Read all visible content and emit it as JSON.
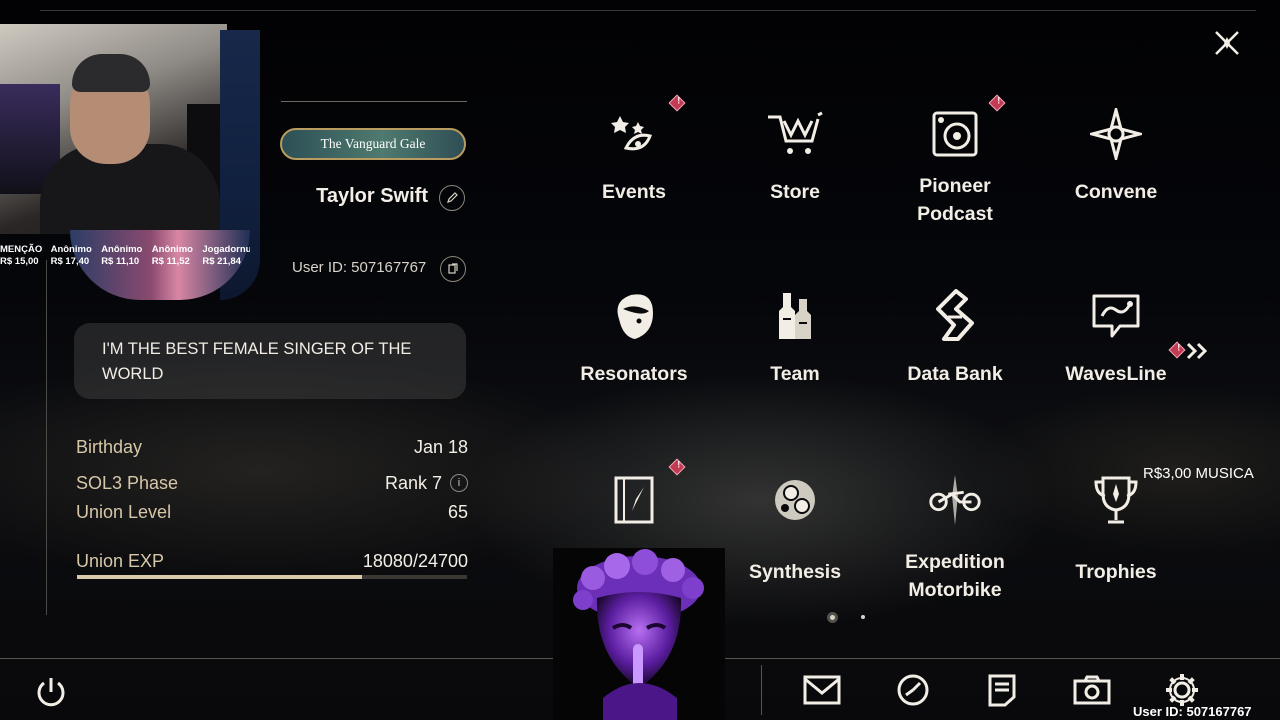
{
  "overlay": {
    "donors": [
      {
        "name": "MENÇÃO",
        "amount": "R$ 15,00"
      },
      {
        "name": "Anônimo",
        "amount": "R$ 17,40"
      },
      {
        "name": "Anônimo",
        "amount": "R$ 11,10"
      },
      {
        "name": "Anônimo",
        "amount": "R$ 11,52"
      },
      {
        "name": "Jogadornume",
        "amount": "R$ 21,84"
      }
    ],
    "music_donation": "R$3,00 MUSICA",
    "bottom_uid": "User ID: 507167767"
  },
  "profile": {
    "title_badge": "The Vanguard Gale",
    "name": "Taylor Swift",
    "user_id": "User ID: 507167767",
    "signature": "I'M THE BEST FEMALE SINGER OF THE WORLD",
    "stats": {
      "birthday_label": "Birthday",
      "birthday_value": "Jan 18",
      "phase_label": "SOL3 Phase",
      "phase_value": "Rank 7",
      "union_level_label": "Union Level",
      "union_level_value": "65",
      "exp_label": "Union EXP",
      "exp_value": "18080/24700",
      "exp_fraction": 0.732
    }
  },
  "menu": {
    "events": "Events",
    "store": "Store",
    "podcast_line1": "Pioneer",
    "podcast_line2": "Podcast",
    "convene": "Convene",
    "resonators": "Resonators",
    "team": "Team",
    "data_bank": "Data Bank",
    "wavesline": "WavesLine",
    "synthesis": "Synthesis",
    "motorbike_line1": "Expedition",
    "motorbike_line2": "Motorbike",
    "trophies": "Trophies",
    "page_count": 2,
    "current_page": 1
  },
  "icons": {
    "close": "close-icon",
    "power": "power-icon",
    "mail": "mail-icon",
    "clock": "clock-icon",
    "notes": "notes-icon",
    "camera": "camera-icon",
    "settings": "gear-icon"
  },
  "colors": {
    "accent_gold": "#d6c7a8",
    "alert_red": "#c23b52",
    "text_light": "#f2eee6"
  }
}
